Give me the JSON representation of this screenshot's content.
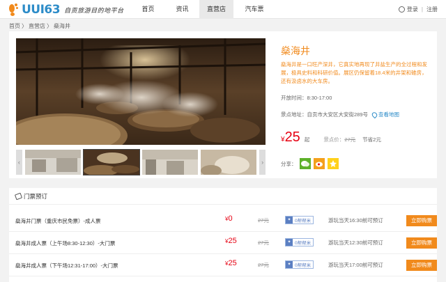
{
  "header": {
    "logo_text": "UUI63",
    "slogan": "自贡旅游目的地平台",
    "nav": [
      "首页",
      "资讯",
      "直营店",
      "汽车票"
    ],
    "login": "登录",
    "register": "注册",
    "separator": "|"
  },
  "breadcrumb": [
    "首页",
    "直营店",
    "燊海井"
  ],
  "breadcrumb_sep": "〉",
  "scenic": {
    "title": "燊海井",
    "description": "燊海井是一口旺产深井，它真实地再现了井盐生产的全过程和发展，极具史料和科研价值。展区仍保留着18.4米的井架和碓房，还有汲卤水的大车房。",
    "hours_label": "开放时间：",
    "hours": "8:30-17:00",
    "address_label": "景点地址：",
    "address": "自贡市大安区大安街289号",
    "map_link": "查看地图",
    "price_currency": "¥",
    "price": "25",
    "price_unit": "起",
    "orig_label": "景点价：",
    "orig_price": "27元",
    "save_label": "节省",
    "save_value": "2元",
    "share_label": "分享："
  },
  "tickets": {
    "heading": "门票预订",
    "rows": [
      {
        "name": "燊海井门票（重庆市民免票）-成人票",
        "currency": "¥",
        "price": "0",
        "orig": "27元",
        "tag": "0帮帮米",
        "note": "游玩当天16:30前可预订",
        "button": "立即购票"
      },
      {
        "name": "燊海井成人票（上午场8:30-12:30）-大门票",
        "currency": "¥",
        "price": "25",
        "orig": "27元",
        "tag": "0帮帮米",
        "note": "游玩当天12:30前可预订",
        "button": "立即购票"
      },
      {
        "name": "燊海井成人票（下午场12:31-17:00）-大门票",
        "currency": "¥",
        "price": "25",
        "orig": "27元",
        "tag": "0帮帮米",
        "note": "游玩当天17:00前可预订",
        "button": "立即购票"
      }
    ]
  },
  "colors": {
    "accent": "#f18a1c",
    "price": "#e60012",
    "link": "#2d8cc8"
  },
  "icons": [
    "logo-icon",
    "user-icon",
    "map-pin-icon",
    "wechat-icon",
    "weibo-icon",
    "qzone-icon",
    "ticket-icon",
    "gift-icon",
    "arrow-left-icon",
    "arrow-right-icon"
  ]
}
